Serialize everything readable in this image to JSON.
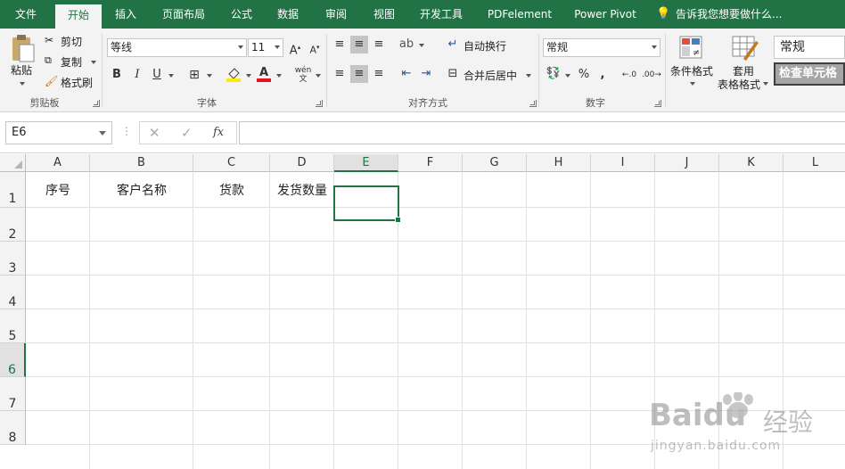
{
  "tabs": [
    {
      "label": "文件"
    },
    {
      "label": "开始"
    },
    {
      "label": "插入"
    },
    {
      "label": "页面布局"
    },
    {
      "label": "公式"
    },
    {
      "label": "数据"
    },
    {
      "label": "审阅"
    },
    {
      "label": "视图"
    },
    {
      "label": "开发工具"
    },
    {
      "label": "PDFelement"
    },
    {
      "label": "Power Pivot"
    }
  ],
  "tell_me": "告诉我您想要做什么...",
  "clipboard": {
    "paste": "粘贴",
    "cut": "剪切",
    "copy": "复制",
    "format_painter": "格式刷",
    "label": "剪贴板"
  },
  "font": {
    "name": "等线",
    "size": "11",
    "bold": "B",
    "italic": "I",
    "underline": "U",
    "phonetic": "wén",
    "label": "字体",
    "font_color": "#e81123",
    "highlight_color": "#ffeb00"
  },
  "alignment": {
    "wrap": "自动换行",
    "merge": "合并后居中",
    "label": "对齐方式"
  },
  "number": {
    "format": "常规",
    "label": "数字",
    "percent": "%",
    "comma": ","
  },
  "styles": {
    "conditional": "条件格式",
    "table_line1": "套用",
    "table_line2": "表格格式",
    "style_normal": "常规",
    "style_check": "检查单元格"
  },
  "namebox": "E6",
  "fx_label": "fx",
  "formula_value": "",
  "columns": [
    "A",
    "B",
    "C",
    "D",
    "E",
    "F",
    "G",
    "H",
    "I",
    "J",
    "K",
    "L"
  ],
  "rows": [
    "1",
    "2",
    "3",
    "4",
    "5",
    "6",
    "7",
    "8"
  ],
  "cells": {
    "A1": "序号",
    "B1": "客户名称",
    "C1": "货款",
    "D1": "发货数量"
  },
  "active_cell": "E6",
  "watermark": {
    "brand": "Baidu",
    "brand2": "经验",
    "url": "jingyan.baidu.com"
  }
}
